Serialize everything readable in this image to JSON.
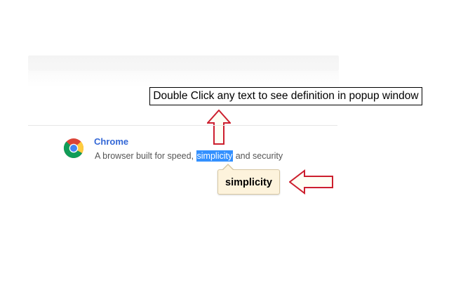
{
  "instruction": {
    "text": "Double Click any text to see definition in popup window"
  },
  "result": {
    "title": "Chrome",
    "description_before": "A browser built for speed, ",
    "description_selected": "simplicity",
    "description_after": " and security",
    "icon": "chrome-logo-icon"
  },
  "popup": {
    "word": "simplicity"
  },
  "colors": {
    "accent_link": "#3367d6",
    "selection": "#3390ff",
    "callout_arrow": "#cc1f2e",
    "popup_background": "#fdf3dc"
  }
}
